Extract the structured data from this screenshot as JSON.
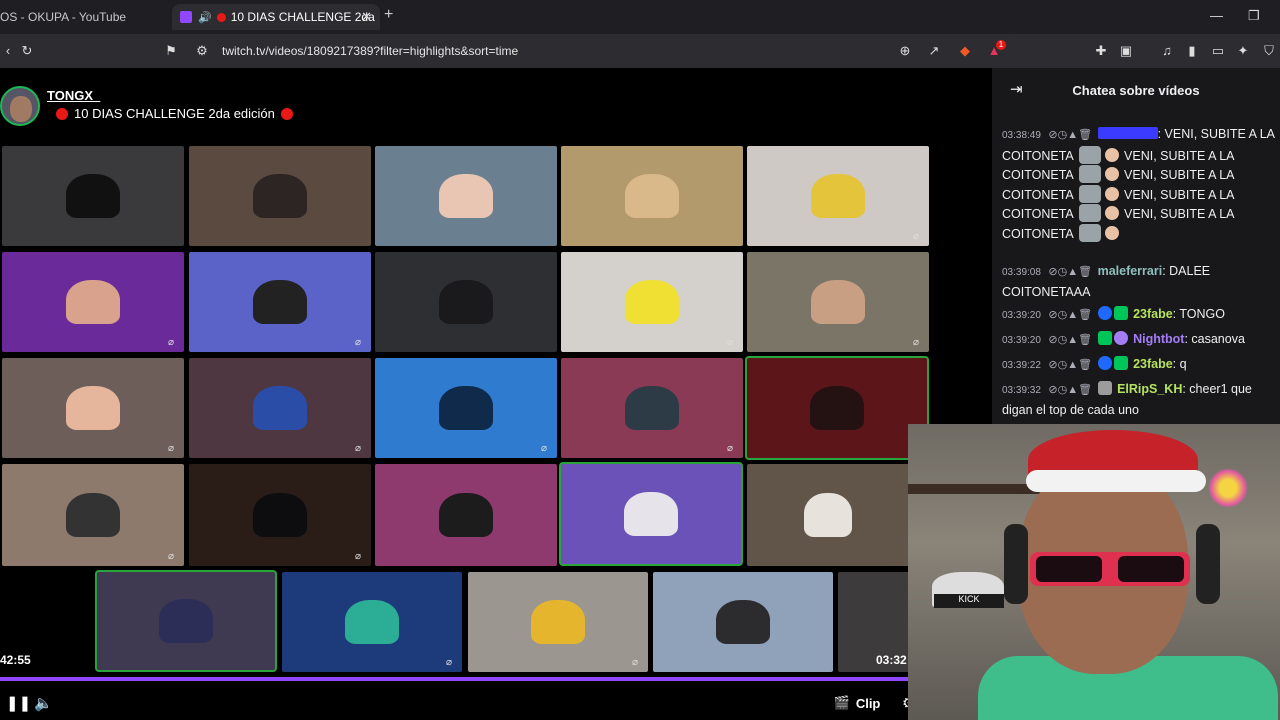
{
  "browser": {
    "tab1_title": "OS - OKUPA - YouTube",
    "tab2_title": "10 DIAS CHALLENGE 2da",
    "url": "twitch.tv/videos/1809217389?filter=highlights&sort=time",
    "notif_count": "1"
  },
  "stream": {
    "channel": "TONGX_",
    "title": "10 DIAS CHALLENGE 2da edición"
  },
  "player": {
    "time_left": "42:55",
    "time_right": "03:32",
    "progress": 0.92,
    "clip_label": "Clip"
  },
  "chat": {
    "header": "Chatea sobre vídeos",
    "messages": [
      {
        "time": "03:38:49",
        "user": "",
        "user_color": "#3b3bff",
        "text": ": VENI, SUBITE A LA COITONETA"
      },
      {
        "time": "",
        "user": "",
        "user_color": "#ffffff",
        "text": "VENI, SUBITE A LA COITONETA"
      },
      {
        "time": "",
        "user": "",
        "user_color": "#ffffff",
        "text": "VENI, SUBITE A LA COITONETA"
      },
      {
        "time": "",
        "user": "",
        "user_color": "#ffffff",
        "text": "VENI, SUBITE A LA COITONETA"
      },
      {
        "time": "",
        "user": "",
        "user_color": "#ffffff",
        "text": "VENI, SUBITE A LA COITONETA"
      },
      {
        "time": "03:39:08",
        "user": "maleferrari",
        "user_color": "#8fbfbf",
        "text": ": DALEE COITONETAAA"
      },
      {
        "time": "03:39:20",
        "user": "23fabe",
        "user_color": "#b6e35f",
        "text": ": TONGO"
      },
      {
        "time": "03:39:20",
        "user": "Nightbot",
        "user_color": "#a47df5",
        "text": ": casanova"
      },
      {
        "time": "03:39:22",
        "user": "23fabe",
        "user_color": "#b6e35f",
        "text": ": q"
      },
      {
        "time": "03:39:32",
        "user": "ElRipS_KH",
        "user_color": "#b6e35f",
        "text": ": cheer1 que digan el top de cada uno"
      }
    ]
  },
  "colors": {
    "accent": "#9147ff",
    "highlight_border": "#2aa43a"
  }
}
